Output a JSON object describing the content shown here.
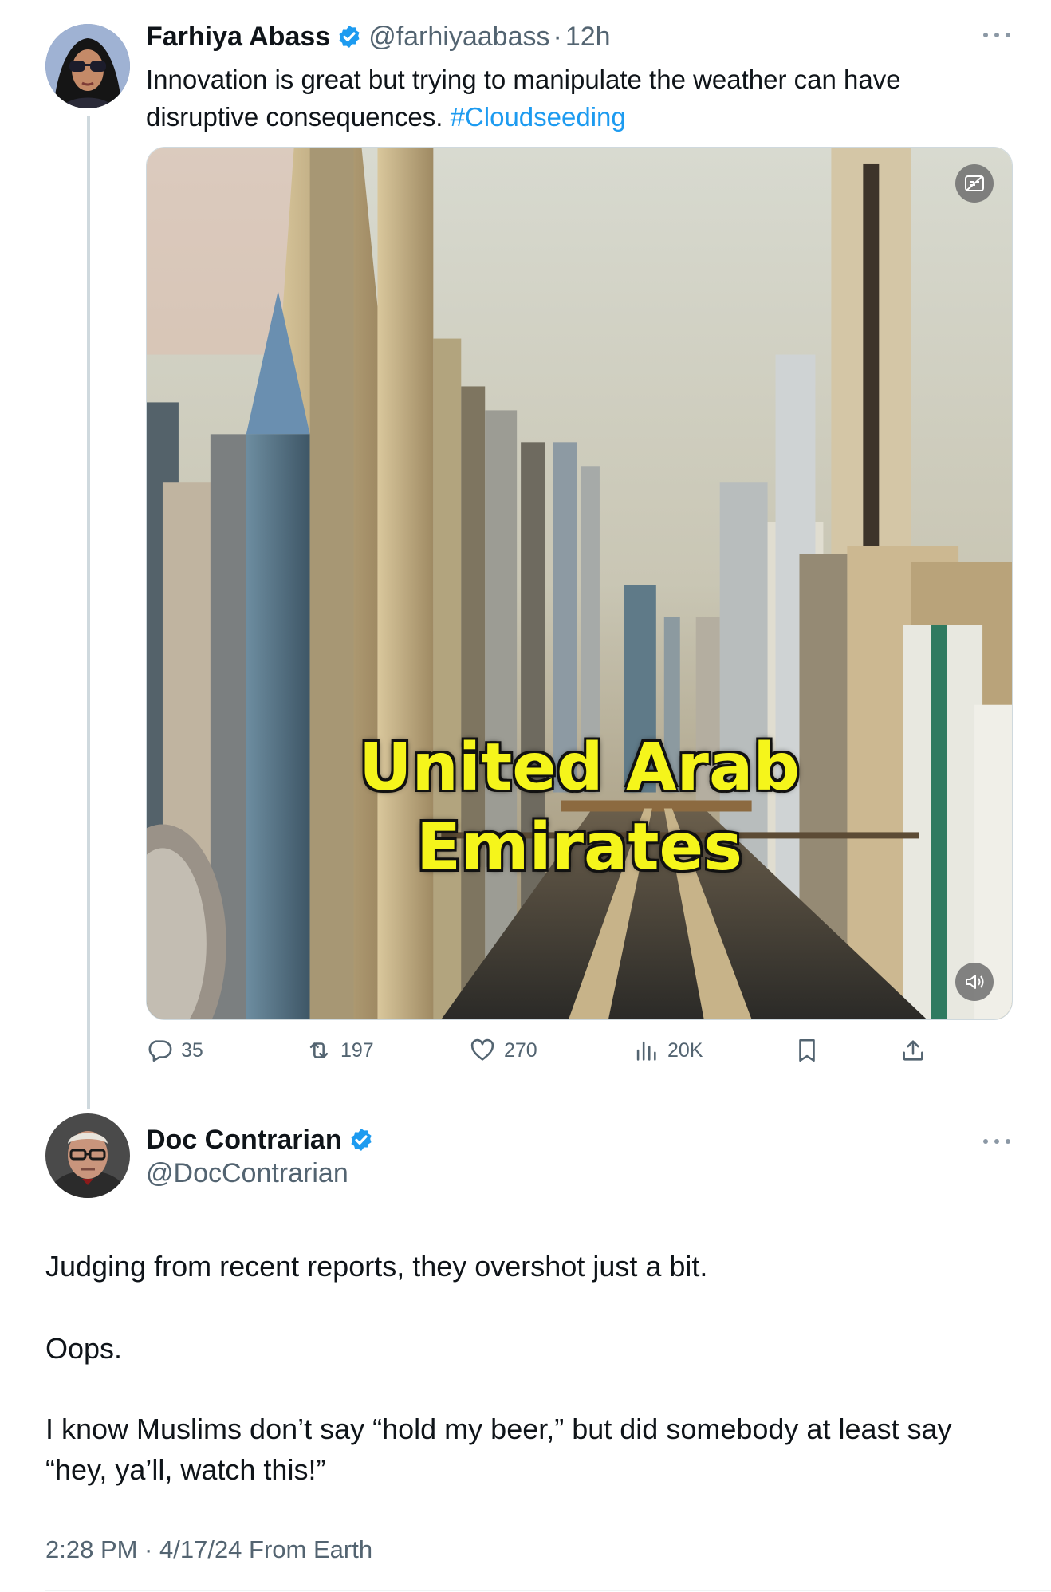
{
  "parent_tweet": {
    "author_name": "Farhiya Abass",
    "handle": "@farhiyaabass",
    "separator": "·",
    "time_ago": "12h",
    "text": "Innovation is great but trying to manipulate the weather can have disruptive consequences.",
    "hashtag": "#Cloudseeding",
    "media": {
      "caption_line1": "United Arab",
      "caption_line2": "Emirates"
    },
    "stats": {
      "replies": "35",
      "reposts": "197",
      "likes": "270",
      "views": "20K"
    }
  },
  "reply_tweet": {
    "author_name": "Doc Contrarian",
    "handle": "@DocContrarian",
    "paragraph1": "Judging from recent reports, they overshot just a bit.",
    "paragraph2": "Oops.",
    "paragraph3": "I know Muslims don’t say “hold my beer,” but did somebody at least say “hey, ya’ll, watch this!”",
    "timestamp": "2:28 PM · 4/17/24 From Earth"
  },
  "colors": {
    "accent": "#1d9bf0",
    "text": "#0f1419",
    "secondary": "#536471",
    "caption": "#f5f51b"
  },
  "icons": [
    "verified-badge-icon",
    "more-icon",
    "reply-icon",
    "repost-icon",
    "like-icon",
    "views-icon",
    "bookmark-icon",
    "share-icon",
    "captions-icon",
    "volume-icon"
  ]
}
